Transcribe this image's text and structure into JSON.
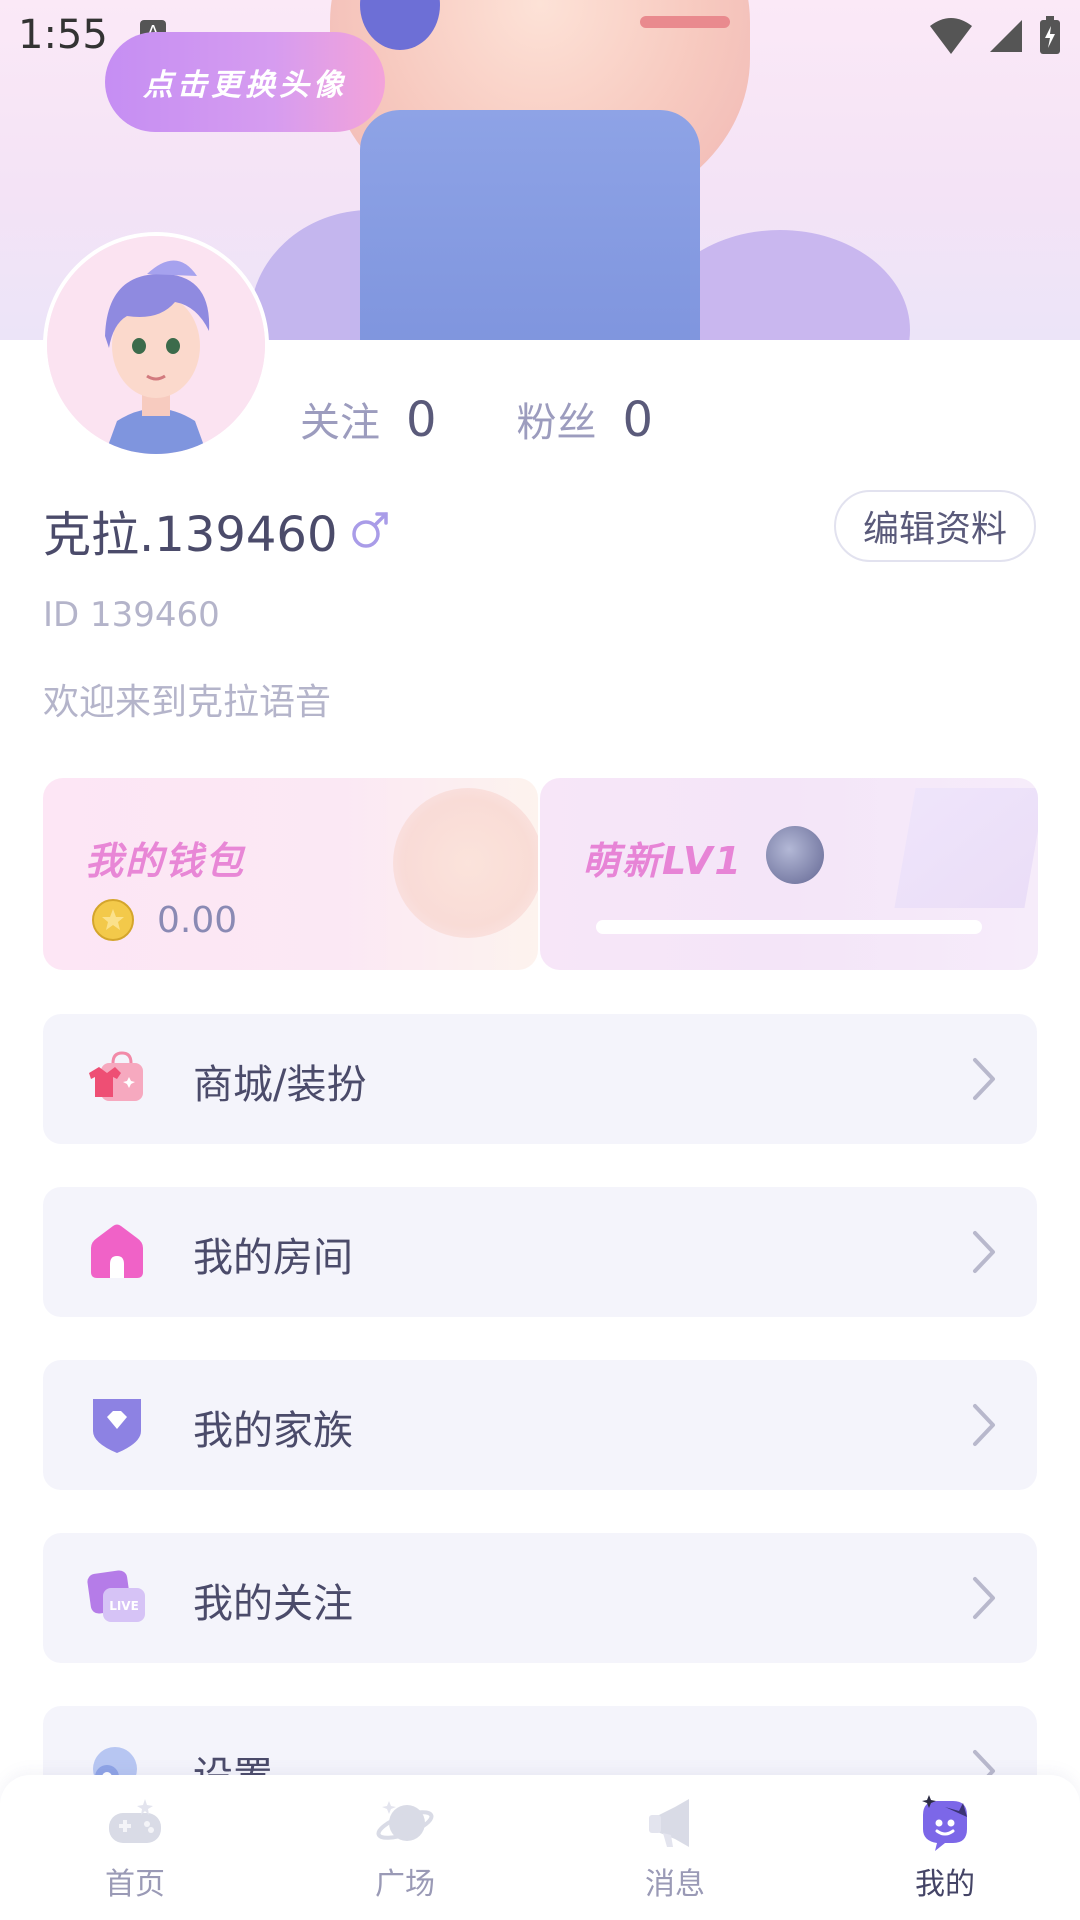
{
  "status_bar": {
    "time": "1:55",
    "notif_letter": "A"
  },
  "header": {
    "change_avatar_label": "点击更换头像"
  },
  "stats": [
    {
      "label": "关注",
      "value": "0"
    },
    {
      "label": "粉丝",
      "value": "0"
    }
  ],
  "profile": {
    "username": "克拉.139460",
    "gender_symbol": "♂",
    "edit_label": "编辑资料",
    "user_id": "ID 139460",
    "welcome": "欢迎来到克拉语音"
  },
  "cards": {
    "wallet": {
      "title": "我的钱包",
      "amount": "0.00"
    },
    "level": {
      "title": "萌新LV1",
      "progress": 0
    }
  },
  "menu": [
    {
      "label": "商城/装扮"
    },
    {
      "label": "我的房间"
    },
    {
      "label": "我的家族"
    },
    {
      "label": "我的关注"
    },
    {
      "label": "设置"
    }
  ],
  "bottom_nav": [
    {
      "label": "首页"
    },
    {
      "label": "广场"
    },
    {
      "label": "消息"
    },
    {
      "label": "我的",
      "active": true
    }
  ],
  "colors": {
    "accent_pink": "#e784d6",
    "menu_bg": "#f4f4fb",
    "text_dark": "#4b4b6a",
    "text_muted": "#b4b4ca"
  }
}
